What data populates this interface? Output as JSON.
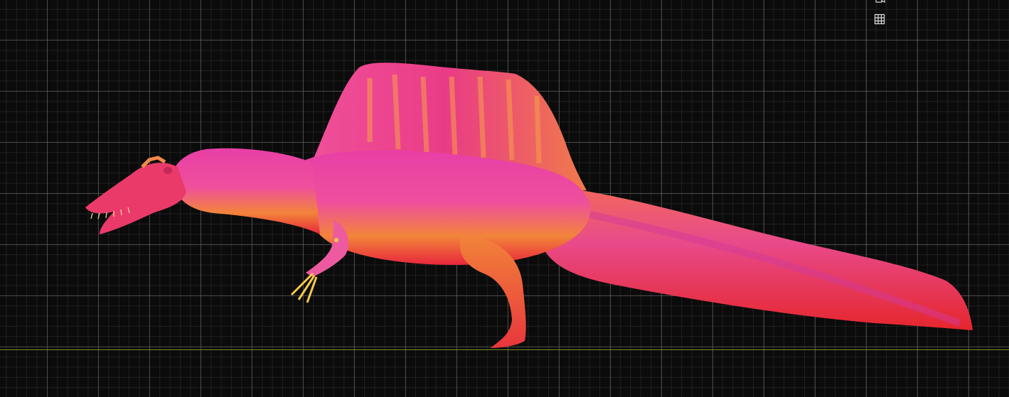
{
  "viewport": {
    "background_color": "#0b0b0b",
    "grid_color": "#6e6e6e",
    "ground_line_color": "#7a8a2a"
  },
  "model": {
    "subject": "spinosaurus-sculpt",
    "shading": "normal-map-matcap",
    "colors": {
      "base_red": "#e8273c",
      "magenta": "#e83fa6",
      "orange": "#f2843a",
      "yellow": "#f6c94a"
    }
  },
  "toolbar": {
    "icons": [
      "camera-icon",
      "grid-toggle-icon"
    ]
  }
}
